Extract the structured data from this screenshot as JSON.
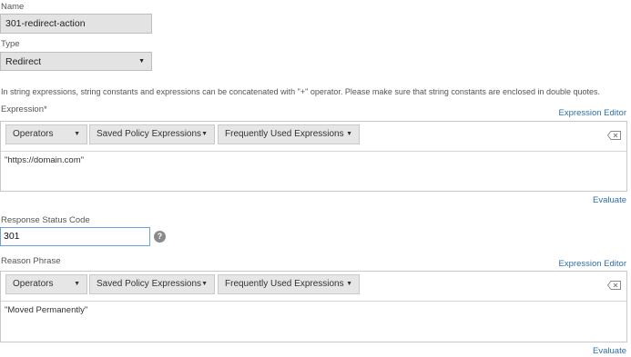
{
  "name": {
    "label": "Name",
    "value": "301-redirect-action"
  },
  "type": {
    "label": "Type",
    "value": "Redirect"
  },
  "info_text": "In string expressions, string constants and expressions can be concatenated with \"+\" operator. Please make sure that string constants are enclosed in double quotes.",
  "expression": {
    "label": "Expression*",
    "editor_link": "Expression Editor",
    "toolbar": {
      "operators": "Operators",
      "saved": "Saved Policy Expressions",
      "frequent": "Frequently Used Expressions"
    },
    "value": "\"https://domain.com\"",
    "evaluate_link": "Evaluate"
  },
  "status_code": {
    "label": "Response Status Code",
    "value": "301",
    "help_icon": "question-mark-icon"
  },
  "reason": {
    "label": "Reason Phrase",
    "editor_link": "Expression Editor",
    "toolbar": {
      "operators": "Operators",
      "saved": "Saved Policy Expressions",
      "frequent": "Frequently Used Expressions"
    },
    "value": "\"Moved Permanently\"",
    "evaluate_link": "Evaluate"
  },
  "colors": {
    "link": "#2f6ea8",
    "field_bg": "#e3e3e3",
    "focus_border": "#6ea2d6"
  }
}
